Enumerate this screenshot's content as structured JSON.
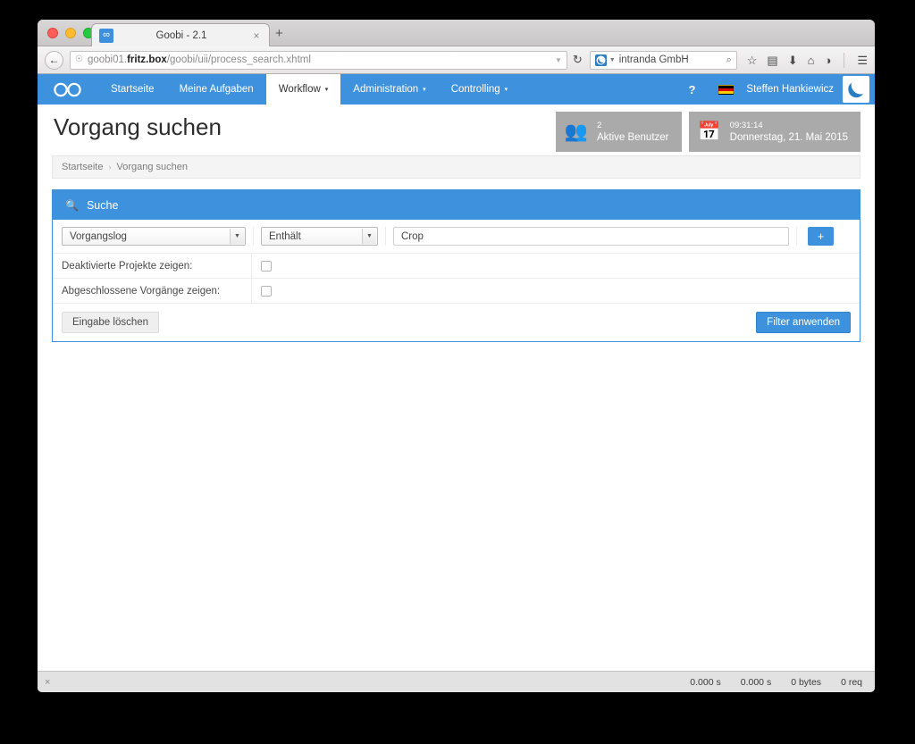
{
  "browser": {
    "tab": {
      "favicon": "infinity-icon",
      "title": "Goobi - 2.1",
      "close": "×",
      "newtab": "+"
    },
    "toolbar": {
      "back": "←",
      "globe_icon": "ἱ0",
      "url_sub": "goobi01.",
      "url_main": "fritz.box",
      "url_path": "/goobi/uii/process_search.xhtml",
      "url_dropdown": "▼",
      "reload": "↻",
      "search_value": "intranda GmbH",
      "search_caret": "▼",
      "search_mag": "⌕",
      "icons": [
        "star-icon",
        "reader-icon",
        "download-icon",
        "home-icon",
        "chat-icon",
        "menu-icon"
      ],
      "icon_glyphs": [
        "☆",
        "▤",
        "⬇",
        "⌂",
        "◑",
        "☰"
      ]
    },
    "statusbar": {
      "close": "×",
      "metrics": [
        "0.000 s",
        "0.000 s",
        "0 bytes",
        "0 req"
      ]
    }
  },
  "app": {
    "brand_icon": "∞",
    "nav": [
      {
        "label": "Startseite",
        "active": false,
        "caret": ""
      },
      {
        "label": "Meine Aufgaben",
        "active": false,
        "caret": ""
      },
      {
        "label": "Workflow",
        "active": true,
        "caret": "▾"
      },
      {
        "label": "Administration",
        "active": false,
        "caret": "▾"
      },
      {
        "label": "Controlling",
        "active": false,
        "caret": "▾"
      }
    ],
    "help_label": "?",
    "language_flag": "de-flag-icon",
    "user_name": "Steffen Hankiewicz",
    "user_logo": "intranda-logo-icon",
    "accent_color": "#3d91dd",
    "infobox_color": "#aaaaaa"
  },
  "header": {
    "page_title": "Vorgang suchen",
    "active_users": {
      "icon": "users-icon",
      "count": "2",
      "label": "Aktive Benutzer"
    },
    "clock": {
      "icon": "calendar-icon",
      "time": "09:31:14",
      "date": "Donnerstag, 21. Mai 2015"
    }
  },
  "breadcrumb": {
    "home": "Startseite",
    "separator": "›",
    "current": "Vorgang suchen"
  },
  "search_panel": {
    "header_icon": "magnifier-icon",
    "header_title": "Suche",
    "filter_row": {
      "field_select": {
        "value": "Vorgangslog",
        "caret": "▼"
      },
      "operator_select": {
        "value": "Enthält",
        "caret": "▼"
      },
      "value_input": {
        "value": "Crop",
        "placeholder": ""
      },
      "add_button": "+"
    },
    "options": [
      {
        "label": "Deaktivierte Projekte zeigen:",
        "checked": false
      },
      {
        "label": "Abgeschlossene Vorgänge zeigen:",
        "checked": false
      }
    ],
    "footer": {
      "reset_label": "Eingabe löschen",
      "apply_label": "Filter anwenden"
    }
  }
}
